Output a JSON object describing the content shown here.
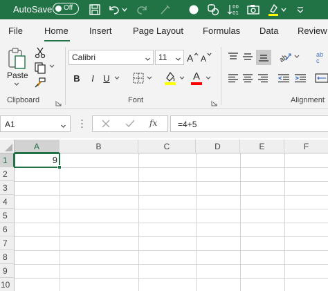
{
  "titlebar": {
    "autosave_label": "AutoSave",
    "autosave_state": "Off",
    "quick_access_icons": [
      "save-icon",
      "undo-icon",
      "undo-dropdown-icon",
      "redo-icon",
      "format-painter-icon",
      "circle-icon",
      "shapes-icon",
      "sort-icon",
      "camera-icon",
      "highlight-icon",
      "customize-qat-icon"
    ],
    "accent_color": "#217346"
  },
  "tabs": [
    "File",
    "Home",
    "Insert",
    "Page Layout",
    "Formulas",
    "Data",
    "Review"
  ],
  "active_tab": "Home",
  "ribbon": {
    "clipboard": {
      "group_label": "Clipboard",
      "paste_label": "Paste"
    },
    "font": {
      "group_label": "Font",
      "font_name": "Calibri",
      "font_size": "11",
      "bold": "B",
      "italic": "I",
      "underline": "U",
      "font_color_label": "A",
      "highlight_color": "#ffff00",
      "font_color": "#ff0000"
    },
    "alignment": {
      "group_label": "Alignment"
    }
  },
  "formula_bar": {
    "name_box": "A1",
    "formula": "=4+5",
    "fx_label": "fx"
  },
  "sheet": {
    "columns": [
      "A",
      "B",
      "C",
      "D",
      "E",
      "F"
    ],
    "rows": [
      "1",
      "2",
      "3",
      "4",
      "5",
      "6",
      "7",
      "8",
      "9",
      "10"
    ],
    "selected_cell": "A1",
    "cells": {
      "A1": "9"
    }
  }
}
